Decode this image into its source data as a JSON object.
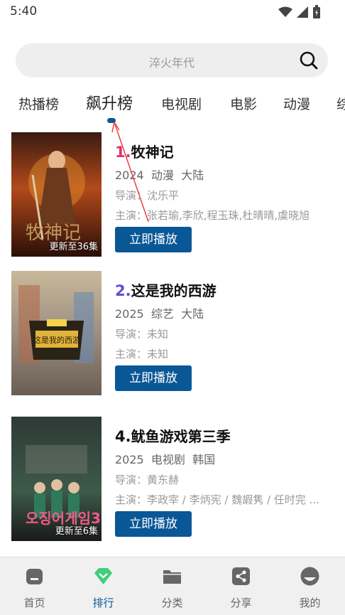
{
  "status": {
    "time": "5:40"
  },
  "search": {
    "placeholder": "淬火年代"
  },
  "tabs": [
    "热播榜",
    "飙升榜",
    "电视剧",
    "电影",
    "动漫",
    "综"
  ],
  "items": [
    {
      "rank": "1.",
      "rank_color": "#e0316f",
      "title": "牧神记",
      "year": "2024",
      "genre": "动漫",
      "region": "大陆",
      "director_label": "导演：",
      "director": "沈乐平",
      "cast_label": "主演：",
      "cast": "张若瑜,李欣,程玉珠,杜晴晴,虞晓旭",
      "badge": "更新至36集",
      "button": "立即播放"
    },
    {
      "rank": "2.",
      "rank_color": "#5b4fd6",
      "title": "这是我的西游",
      "year": "2025",
      "genre": "综艺",
      "region": "大陆",
      "director_label": "导演：",
      "director": "未知",
      "cast_label": "主演：",
      "cast": "未知",
      "badge": "",
      "button": "立即播放"
    },
    {
      "rank": "4.",
      "rank_color": "#111111",
      "title": "鱿鱼游戏第三季",
      "year": "2025",
      "genre": "电视剧",
      "region": "韩国",
      "director_label": "导演：",
      "director": "黄东赫",
      "cast_label": "主演：",
      "cast": "李政宰 / 李炳宪 / 魏嘏隽 / 任时完 ...",
      "badge": "更新至6集",
      "button": "立即播放"
    }
  ],
  "nav": [
    {
      "label": "首页",
      "icon": "home-icon"
    },
    {
      "label": "排行",
      "icon": "rank-icon"
    },
    {
      "label": "分类",
      "icon": "folder-icon"
    },
    {
      "label": "分享",
      "icon": "share-icon"
    },
    {
      "label": "我的",
      "icon": "profile-icon"
    }
  ],
  "colors": {
    "accent": "#0a5796",
    "rank_active": "#3fcf7a"
  }
}
